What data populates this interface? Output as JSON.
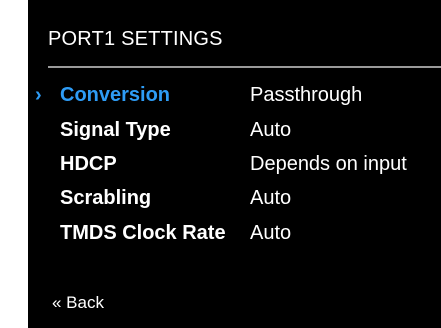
{
  "header": {
    "title": "PORT1 SETTINGS"
  },
  "settings": {
    "selected_marker": "›",
    "items": [
      {
        "label": "Conversion",
        "value": "Passthrough"
      },
      {
        "label": "Signal Type",
        "value": "Auto"
      },
      {
        "label": "HDCP",
        "value": "Depends on input"
      },
      {
        "label": "Scrabling",
        "value": "Auto"
      },
      {
        "label": "TMDS Clock Rate",
        "value": "Auto"
      }
    ]
  },
  "footer": {
    "back_label": "« Back"
  },
  "colors": {
    "background": "#000000",
    "text": "#ffffff",
    "accent": "#2e9cf5",
    "divider": "#9a9a9a"
  },
  "icons": {
    "selected_marker": "chevron-right-icon"
  }
}
